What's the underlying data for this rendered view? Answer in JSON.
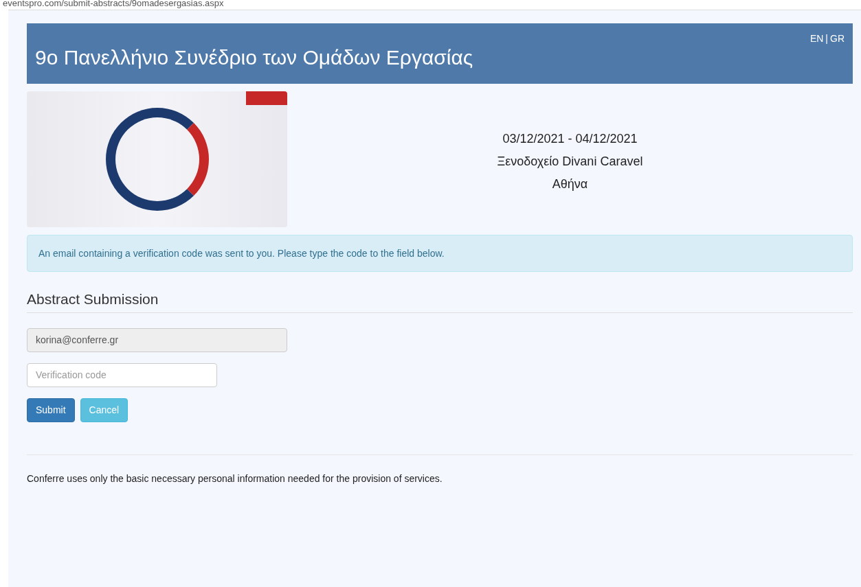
{
  "address_bar": {
    "url": "eventspro.com/submit-abstracts/9omadesergasias.aspx"
  },
  "header": {
    "title": "9ο Πανελλήνιο Συνέδριο των Ομάδων Εργασίας",
    "languages": [
      "EN",
      "|",
      "GR"
    ]
  },
  "event": {
    "dates": "03/12/2021 - 04/12/2021",
    "venue": "Ξενοδοχείο Divani Caravel",
    "city": "Αθήνα"
  },
  "alert": {
    "text": "An email containing a verification code was sent to you. Please type the code to the field below."
  },
  "form": {
    "heading": "Abstract Submission",
    "fields": [
      {
        "value": "korina@conferre.gr",
        "disabled": true
      },
      {
        "placeholder": "Verification code",
        "disabled": false
      }
    ],
    "buttons": [
      {
        "label": "Submit",
        "kind": "primary"
      },
      {
        "label": "Cancel",
        "kind": "secondary"
      }
    ]
  },
  "footer": {
    "text": "Conferre uses only the basic necessary personal information needed for the provision of services."
  }
}
